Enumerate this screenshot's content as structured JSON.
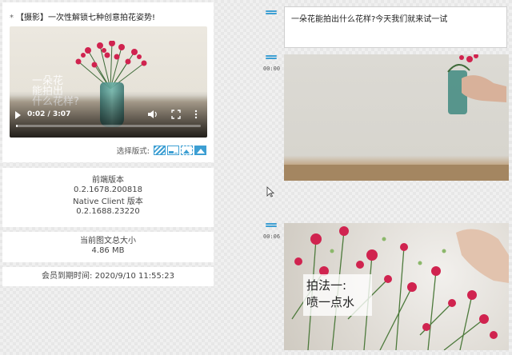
{
  "left": {
    "title": {
      "star": "*",
      "text": "【摄影】一次性解锁七种创意拍花姿势!"
    },
    "video": {
      "overlay_text": "一朵花\n能拍出\n什么花样?",
      "time": "0:02 / 3:07",
      "progress": 0.01,
      "icons": [
        "play-icon",
        "volume-icon",
        "fullscreen-icon",
        "more-options-icon"
      ]
    },
    "layout": {
      "label": "选择版式:",
      "options": [
        "layout-stripes-icon",
        "layout-caption-icon",
        "layout-dashed-image-icon",
        "layout-mountain-icon"
      ],
      "selected_index": 3
    },
    "version": {
      "frontend_label": "前端版本",
      "frontend_value": "0.2.1678.200818",
      "native_label": "Native Client 版本",
      "native_value": "0.2.1688.23220"
    },
    "size": {
      "label": "当前图文总大小",
      "value": "4.86 MB"
    },
    "member": {
      "text": "会员到期时间: 2020/9/10 11:55:23"
    }
  },
  "right": {
    "blocks": [
      {
        "type": "text",
        "text": "一朵花能拍出什么花样?今天我们就来试一试"
      },
      {
        "type": "image",
        "timestamp": "00:00"
      },
      {
        "type": "image",
        "timestamp": "00:06",
        "caption_line1": "拍法一:",
        "caption_line2": "喷一点水"
      }
    ]
  },
  "colors": {
    "accent": "#3d9fd3",
    "flower": "#d0234f"
  }
}
